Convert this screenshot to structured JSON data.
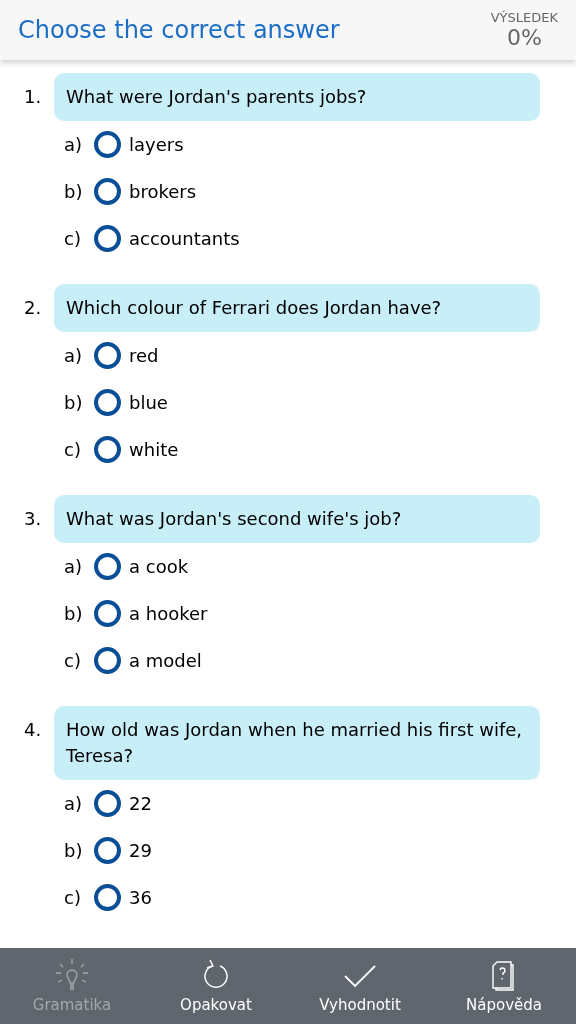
{
  "header": {
    "title": "Choose the correct answer",
    "score_label": "VÝSLEDEK",
    "score": "0%"
  },
  "questions": [
    {
      "number": "1.",
      "text": "What were Jordan's parents jobs?",
      "options": [
        {
          "letter": "a)",
          "text": "layers",
          "selected": false
        },
        {
          "letter": "b)",
          "text": "brokers",
          "selected": false
        },
        {
          "letter": "c)",
          "text": "accountants",
          "selected": false
        }
      ]
    },
    {
      "number": "2.",
      "text": "Which colour of Ferrari does Jordan have?",
      "options": [
        {
          "letter": "a)",
          "text": "red",
          "selected": false
        },
        {
          "letter": "b)",
          "text": "blue",
          "selected": false
        },
        {
          "letter": "c)",
          "text": "white",
          "selected": false
        }
      ]
    },
    {
      "number": "3.",
      "text": "What was Jordan's second wife's job?",
      "options": [
        {
          "letter": "a)",
          "text": "a cook",
          "selected": false
        },
        {
          "letter": "b)",
          "text": "a hooker",
          "selected": false
        },
        {
          "letter": "c)",
          "text": "a model",
          "selected": false
        }
      ]
    },
    {
      "number": "4.",
      "text": "How old was Jordan when he married his first wife, Teresa?",
      "options": [
        {
          "letter": "a)",
          "text": "22",
          "selected": false
        },
        {
          "letter": "b)",
          "text": "29",
          "selected": false
        },
        {
          "letter": "c)",
          "text": "36",
          "selected": false
        }
      ]
    }
  ],
  "toolbar": [
    {
      "label": "Gramatika",
      "disabled": true
    },
    {
      "label": "Opakovat",
      "disabled": false
    },
    {
      "label": "Vyhodnotit",
      "disabled": false
    },
    {
      "label": "Nápověda",
      "disabled": false
    }
  ]
}
